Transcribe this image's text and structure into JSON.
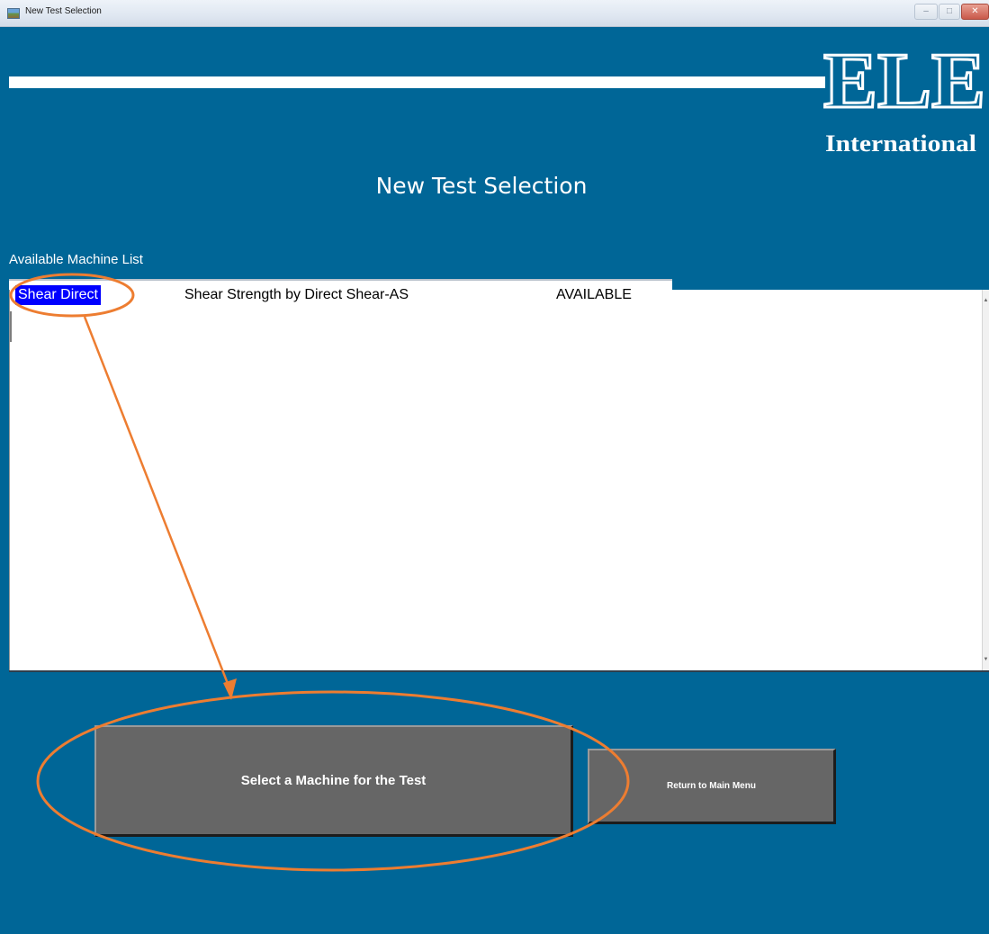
{
  "window": {
    "title": "New Test Selection",
    "icon": "app-icon",
    "controls": {
      "minimize": "–",
      "maximize": "□",
      "close": "✕"
    }
  },
  "logo": {
    "text_main": "ELE",
    "text_sub": "International"
  },
  "screen": {
    "title": "New Test Selection"
  },
  "machine_list": {
    "label": "Available Machine List",
    "rows": [
      {
        "name": "Shear Direct",
        "description": "Shear Strength by Direct Shear-AS",
        "status": "AVAILABLE"
      }
    ]
  },
  "buttons": {
    "select_machine": "Select a Machine for the Test",
    "return_main": "Return to Main Menu"
  },
  "colors": {
    "background": "#006697",
    "selection": "#0000ff",
    "button": "#666666",
    "annotation": "#ed7d31"
  }
}
